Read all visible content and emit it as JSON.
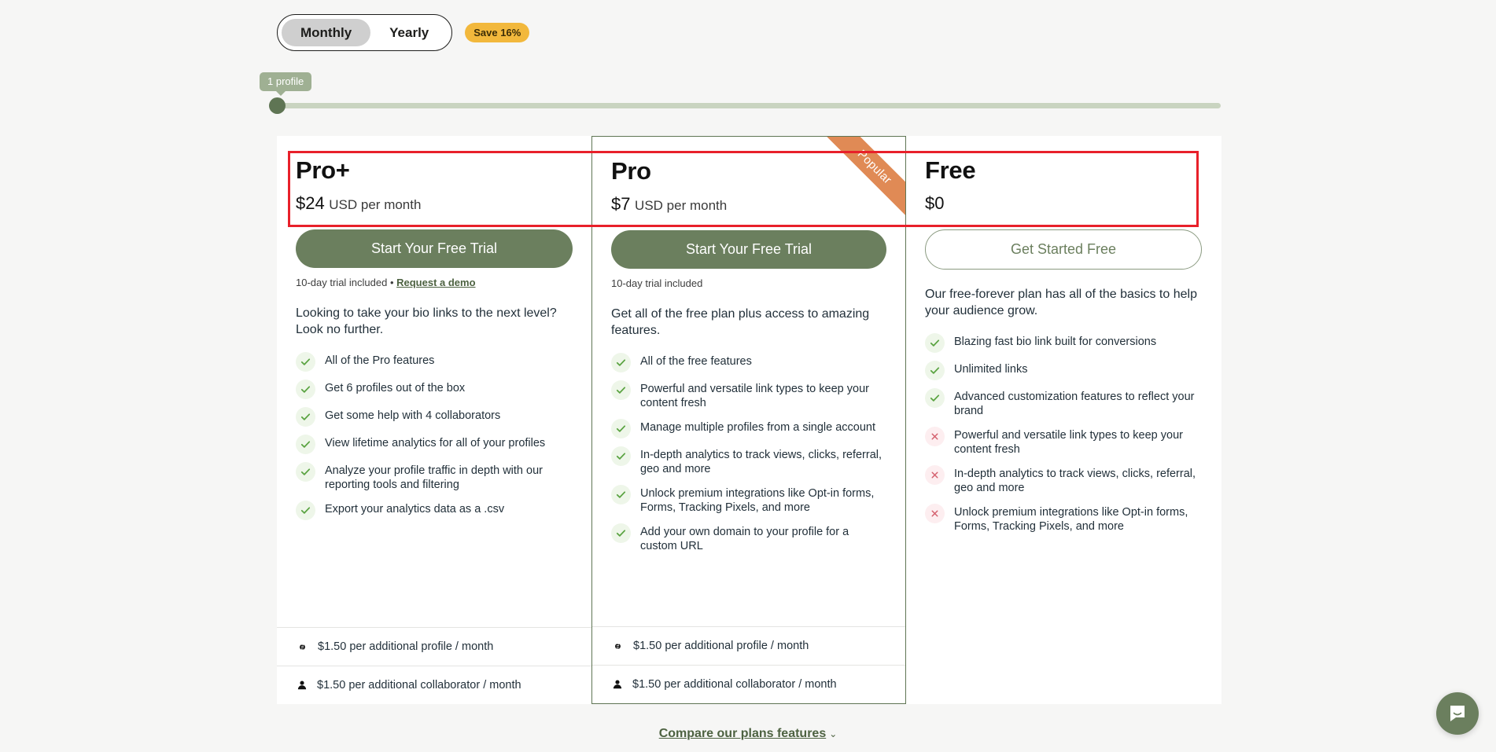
{
  "billing": {
    "options": [
      {
        "label": "Monthly",
        "active": true
      },
      {
        "label": "Yearly",
        "active": false
      }
    ],
    "save_badge": "Save 16%"
  },
  "slider": {
    "tooltip": "1 profile",
    "value": 1,
    "position_percent": 0
  },
  "plans": [
    {
      "name": "Pro+",
      "price_amount": "$24",
      "price_period": "USD per month",
      "cta_label": "Start Your Free Trial",
      "cta_style": "solid",
      "trial_text": "10-day trial included • ",
      "trial_link": "Request a demo",
      "blurb": "Looking to take your bio links to the next level? Look no further.",
      "featured": false,
      "ribbon": "",
      "features": [
        {
          "included": true,
          "text": "All of the Pro features"
        },
        {
          "included": true,
          "text": "Get 6 profiles out of the box"
        },
        {
          "included": true,
          "text": "Get some help with 4 collaborators"
        },
        {
          "included": true,
          "text": "View lifetime analytics for all of your profiles"
        },
        {
          "included": true,
          "text": "Analyze your profile traffic in depth with our reporting tools and filtering"
        },
        {
          "included": true,
          "text": "Export your analytics data as a .csv"
        }
      ],
      "addons": [
        {
          "icon": "link-icon",
          "text": "$1.50 per additional profile / month"
        },
        {
          "icon": "person-icon",
          "text": "$1.50 per additional collaborator / month"
        }
      ]
    },
    {
      "name": "Pro",
      "price_amount": "$7",
      "price_period": "USD per month",
      "cta_label": "Start Your Free Trial",
      "cta_style": "solid",
      "trial_text": "10-day trial included",
      "trial_link": "",
      "blurb": "Get all of the free plan plus access to amazing features.",
      "featured": true,
      "ribbon": "Popular",
      "features": [
        {
          "included": true,
          "text": "All of the free features"
        },
        {
          "included": true,
          "text": "Powerful and versatile link types to keep your content fresh"
        },
        {
          "included": true,
          "text": "Manage multiple profiles from a single account"
        },
        {
          "included": true,
          "text": "In-depth analytics to track views, clicks, referral, geo and more"
        },
        {
          "included": true,
          "text": "Unlock premium integrations like Opt-in forms, Forms, Tracking Pixels, and more"
        },
        {
          "included": true,
          "text": "Add your own domain to your profile for a custom URL"
        }
      ],
      "addons": [
        {
          "icon": "link-icon",
          "text": "$1.50 per additional profile / month"
        },
        {
          "icon": "person-icon",
          "text": "$1.50 per additional collaborator / month"
        }
      ]
    },
    {
      "name": "Free",
      "price_amount": "$0",
      "price_period": "",
      "cta_label": "Get Started Free",
      "cta_style": "outline",
      "trial_text": "",
      "trial_link": "",
      "blurb": "Our free-forever plan has all of the basics to help your audience grow.",
      "featured": false,
      "ribbon": "",
      "features": [
        {
          "included": true,
          "text": "Blazing fast bio link built for conversions"
        },
        {
          "included": true,
          "text": "Unlimited links"
        },
        {
          "included": true,
          "text": "Advanced customization features to reflect your brand"
        },
        {
          "included": false,
          "text": "Powerful and versatile link types to keep your content fresh"
        },
        {
          "included": false,
          "text": "In-depth analytics to track views, clicks, referral, geo and more"
        },
        {
          "included": false,
          "text": "Unlock premium integrations like Opt-in forms, Forms, Tracking Pixels, and more"
        }
      ],
      "addons": []
    }
  ],
  "compare": {
    "label": "Compare our plans features",
    "chevron": "⌄"
  },
  "chat": {
    "icon": "chat-bubble-icon"
  },
  "colors": {
    "brand_green": "#6b7f5e",
    "accent_orange": "#e08a55",
    "badge_yellow": "#f2b83c",
    "annotation_red": "#e8202a",
    "check_green": "#5aa341",
    "cross_red": "#d4606e"
  }
}
